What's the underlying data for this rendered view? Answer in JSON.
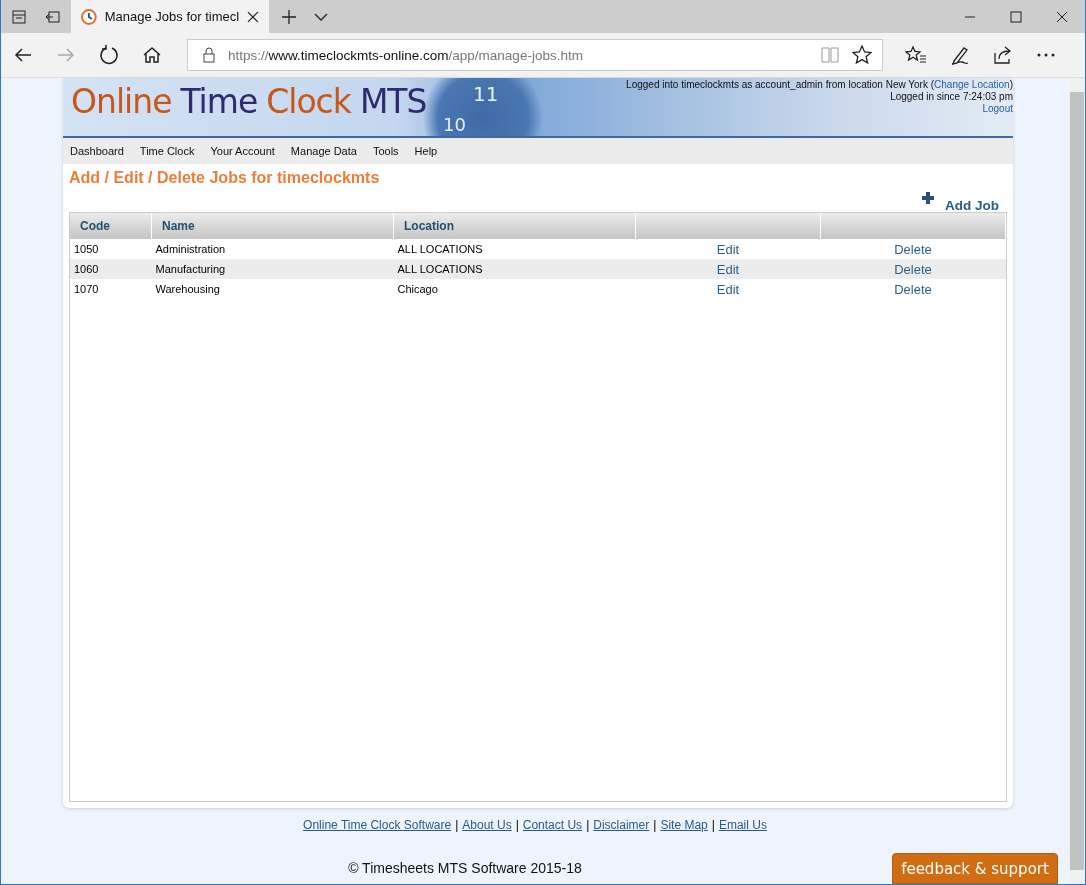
{
  "browser": {
    "tab_title": "Manage Jobs for timecl",
    "url_scheme": "https://",
    "url_host": "www.timeclockmts-online.com",
    "url_path": "/app/manage-jobs.htm"
  },
  "header": {
    "logo": [
      {
        "text": "Online",
        "color": "#c9561a"
      },
      {
        "text": "Time",
        "color": "#2e2a6e"
      },
      {
        "text": "Clock",
        "color": "#c9561a"
      },
      {
        "text": "MTS",
        "color": "#2e2a6e"
      }
    ],
    "clock_numerals": [
      "11",
      "10"
    ],
    "login_before": "Logged into timeclockmts as account_admin from location New York (",
    "login_link": "Change Location",
    "login_after": ")",
    "since": "Logged in since 7:24:03 pm",
    "logout": "Logout"
  },
  "nav": [
    "Dashboard",
    "Time Clock",
    "Your Account",
    "Manage Data",
    "Tools",
    "Help"
  ],
  "page_title": "Add / Edit / Delete Jobs for timeclockmts",
  "add_button": "Add Job",
  "table": {
    "columns": [
      "Code",
      "Name",
      "Location"
    ],
    "rows": [
      {
        "code": "1050",
        "name": "Administration",
        "location": "ALL LOCATIONS",
        "edit": "Edit",
        "delete": "Delete"
      },
      {
        "code": "1060",
        "name": "Manufacturing",
        "location": "ALL LOCATIONS",
        "edit": "Edit",
        "delete": "Delete"
      },
      {
        "code": "1070",
        "name": "Warehousing",
        "location": "Chicago",
        "edit": "Edit",
        "delete": "Delete"
      }
    ]
  },
  "footer_separators": [
    "|",
    "|",
    "|",
    "|",
    "|"
  ],
  "footer_links": [
    "Online Time Clock Software",
    "About Us",
    "Contact Us",
    "Disclaimer",
    "Site Map",
    "Email Us"
  ],
  "copyright": "© Timesheets MTS Software 2015-18",
  "feedback": "feedback & support"
}
